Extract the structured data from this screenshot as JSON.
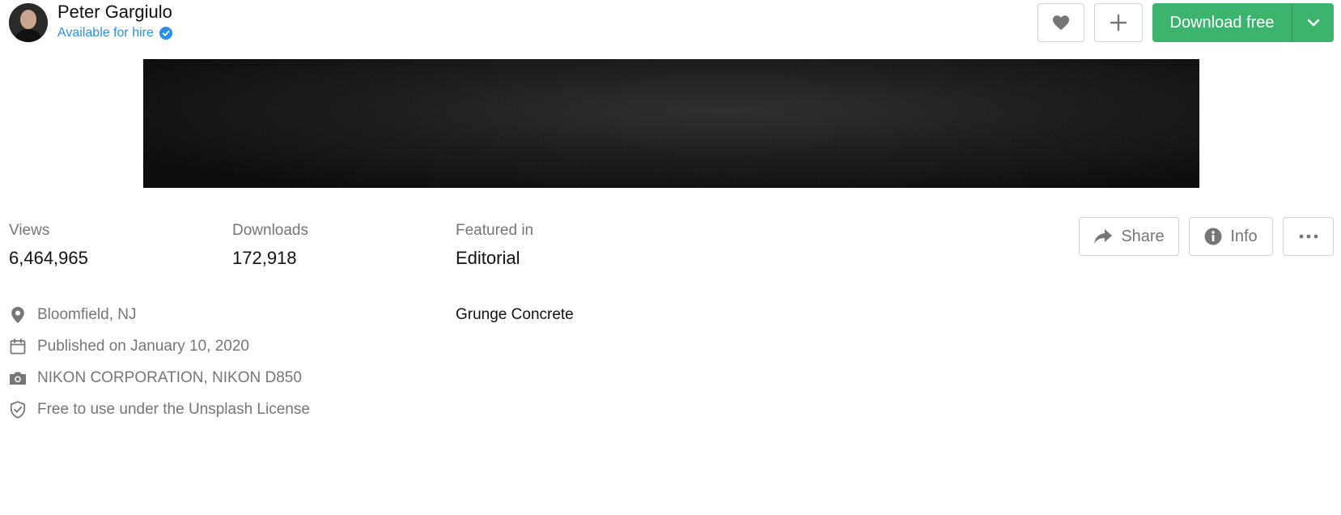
{
  "author": {
    "name": "Peter Gargiulo",
    "status": "Available for hire"
  },
  "toolbar": {
    "like_icon": "heart-icon",
    "add_icon": "plus-icon",
    "download_label": "Download free",
    "download_caret_icon": "chevron-down-icon",
    "accent_color": "#3cb46e"
  },
  "stats": {
    "views_label": "Views",
    "views_value": "6,464,965",
    "downloads_label": "Downloads",
    "downloads_value": "172,918",
    "featured_label": "Featured in",
    "featured_value": "Editorial"
  },
  "actions": {
    "share_label": "Share",
    "info_label": "Info",
    "more_icon": "ellipsis-icon"
  },
  "details": {
    "location": "Bloomfield, NJ",
    "published": "Published on January 10, 2020",
    "camera": "NIKON CORPORATION, NIKON D850",
    "license": "Free to use under the Unsplash License"
  },
  "tags": [
    "Grunge Concrete"
  ]
}
